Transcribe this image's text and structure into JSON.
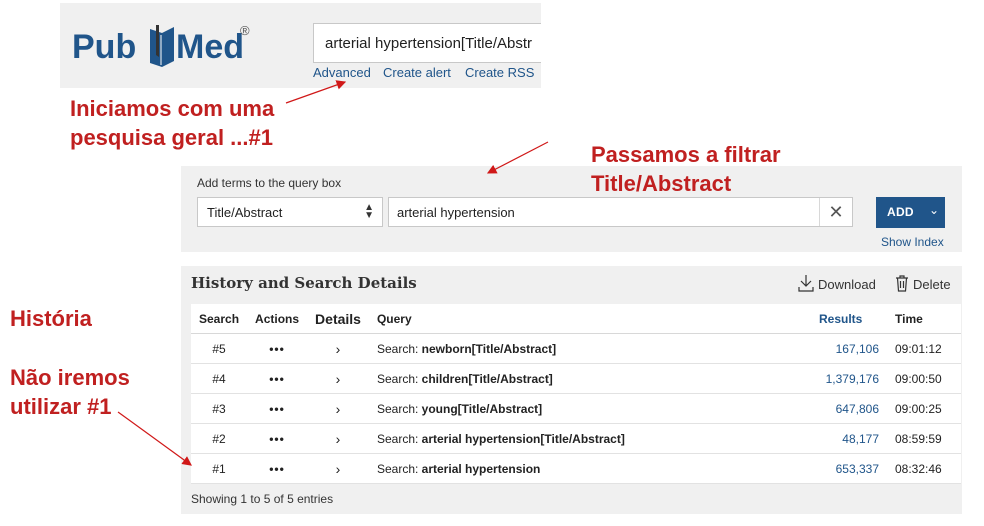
{
  "header": {
    "logo_pub": "Pub",
    "logo_med": "Med",
    "logo_reg": "®",
    "search_value": "arterial hypertension[Title/Abstr",
    "links": [
      "Advanced",
      "Create alert",
      "Create RSS"
    ]
  },
  "annotations": {
    "a1_line1": "Iniciamos com uma",
    "a1_line2": "pesquisa geral ...#1",
    "a2_line1": "Passamos a filtrar",
    "a2_line2": "Title/Abstract",
    "a3": "História",
    "a4_line1": "Não iremos",
    "a4_line2": "utilizar #1",
    "color": "#c02020"
  },
  "builder": {
    "label": "Add terms to the query box",
    "field": "Title/Abstract",
    "term": "arterial hypertension",
    "add_label": "ADD",
    "show_index": "Show Index"
  },
  "history": {
    "title": "History and Search Details",
    "download": "Download",
    "delete": "Delete",
    "columns": [
      "Search",
      "Actions",
      "Details",
      "Query",
      "Results",
      "Time"
    ],
    "rows": [
      {
        "num": "#5",
        "actions": "•••",
        "details": "›",
        "query_prefix": "Search: ",
        "query_term": "newborn[Title/Abstract]",
        "results": "167,106",
        "time": "09:01:12"
      },
      {
        "num": "#4",
        "actions": "•••",
        "details": "›",
        "query_prefix": "Search: ",
        "query_term": "children[Title/Abstract]",
        "results": "1,379,176",
        "time": "09:00:50"
      },
      {
        "num": "#3",
        "actions": "•••",
        "details": "›",
        "query_prefix": "Search: ",
        "query_term": "young[Title/Abstract]",
        "results": "647,806",
        "time": "09:00:25"
      },
      {
        "num": "#2",
        "actions": "•••",
        "details": "›",
        "query_prefix": "Search: ",
        "query_term": "arterial hypertension[Title/Abstract]",
        "results": "48,177",
        "time": "08:59:59"
      },
      {
        "num": "#1",
        "actions": "•••",
        "details": "›",
        "query_prefix": "Search: ",
        "query_term": "arterial hypertension",
        "results": "653,337",
        "time": "08:32:46"
      }
    ],
    "footer": "Showing 1 to 5 of 5 entries"
  },
  "colors": {
    "brand": "#20558a",
    "panel": "#f0f0f0"
  }
}
